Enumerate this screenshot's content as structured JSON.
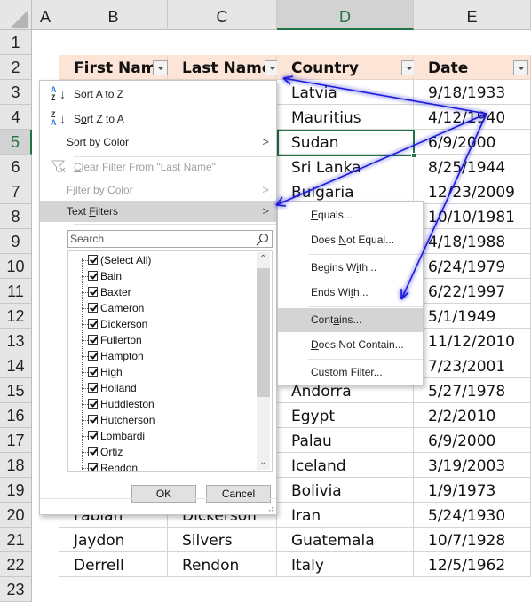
{
  "sheet": {
    "columns": [
      "A",
      "B",
      "C",
      "D",
      "E"
    ],
    "active_column": "D",
    "rows": [
      "1",
      "2",
      "3",
      "4",
      "5",
      "6",
      "7",
      "8",
      "9",
      "10",
      "11",
      "12",
      "13",
      "14",
      "15",
      "16",
      "17",
      "18",
      "19",
      "20",
      "21",
      "22",
      "23"
    ],
    "active_row": "5",
    "table_headers": [
      "First Name",
      "Last Name",
      "Country",
      "Date"
    ],
    "countries": [
      "Latvia",
      "Mauritius",
      "Sudan",
      "Sri Lanka",
      "Bulgaria",
      "",
      "",
      "",
      "",
      "",
      "",
      "",
      "Andorra",
      "Egypt",
      "Palau",
      "Iceland",
      "Bolivia",
      "Iran",
      "Guatemala",
      "Italy"
    ],
    "dates": [
      "9/18/1933",
      "4/12/1940",
      "6/9/2000",
      "8/25/1944",
      "12/23/2009",
      "10/10/1981",
      "4/18/1988",
      "6/24/1979",
      "6/22/1997",
      "5/1/1949",
      "11/12/2010",
      "7/23/2001",
      "5/27/1978",
      "2/2/2010",
      "6/9/2000",
      "3/19/2003",
      "1/9/1973",
      "5/24/1930",
      "10/7/1928",
      "12/5/1962"
    ],
    "visible_rows_below_menu": [
      {
        "first": "Fabian",
        "last": "Dickerson"
      },
      {
        "first": "Jaydon",
        "last": "Silvers"
      },
      {
        "first": "Derrell",
        "last": "Rendon"
      }
    ],
    "colors": {
      "header_fill": "#fce4d6",
      "accent_green": "#217346",
      "annotation_arrow": "#1a1adb"
    }
  },
  "filter_menu": {
    "sort_az": {
      "pre": "",
      "ul": "S",
      "post": "ort A to Z"
    },
    "sort_za": {
      "pre": "S",
      "ul": "o",
      "post": "rt Z to A"
    },
    "sort_by_color": {
      "pre": "Sor",
      "ul": "t",
      "post": " by Color"
    },
    "clear_filter": {
      "pre": "",
      "ul": "C",
      "post": "lear Filter From \"Last Name\""
    },
    "filter_by_color": {
      "pre": "F",
      "ul": "i",
      "post": "lter by Color"
    },
    "text_filters": {
      "pre": "Text ",
      "ul": "F",
      "post": "ilters"
    },
    "chevron": ">",
    "search_placeholder": "Search",
    "list_items": [
      "(Select All)",
      "Bain",
      "Baxter",
      "Cameron",
      "Dickerson",
      "Fullerton",
      "Hampton",
      "High",
      "Holland",
      "Huddleston",
      "Hutcherson",
      "Lombardi",
      "Ortiz",
      "Rendon"
    ],
    "ok_label": "OK",
    "cancel_label": "Cancel"
  },
  "text_filters_submenu": {
    "equals": {
      "pre": "",
      "ul": "E",
      "post": "quals..."
    },
    "does_not_equal": {
      "pre": "Does ",
      "ul": "N",
      "post": "ot Equal..."
    },
    "begins_with": {
      "pre": "Begins W",
      "ul": "i",
      "post": "th..."
    },
    "ends_with": {
      "pre": "Ends Wi",
      "ul": "t",
      "post": "h..."
    },
    "contains": {
      "pre": "Cont",
      "ul": "a",
      "post": "ins..."
    },
    "does_not_contain": {
      "pre": "",
      "ul": "D",
      "post": "oes Not Contain..."
    },
    "custom_filter": {
      "pre": "Custom ",
      "ul": "F",
      "post": "ilter..."
    }
  }
}
